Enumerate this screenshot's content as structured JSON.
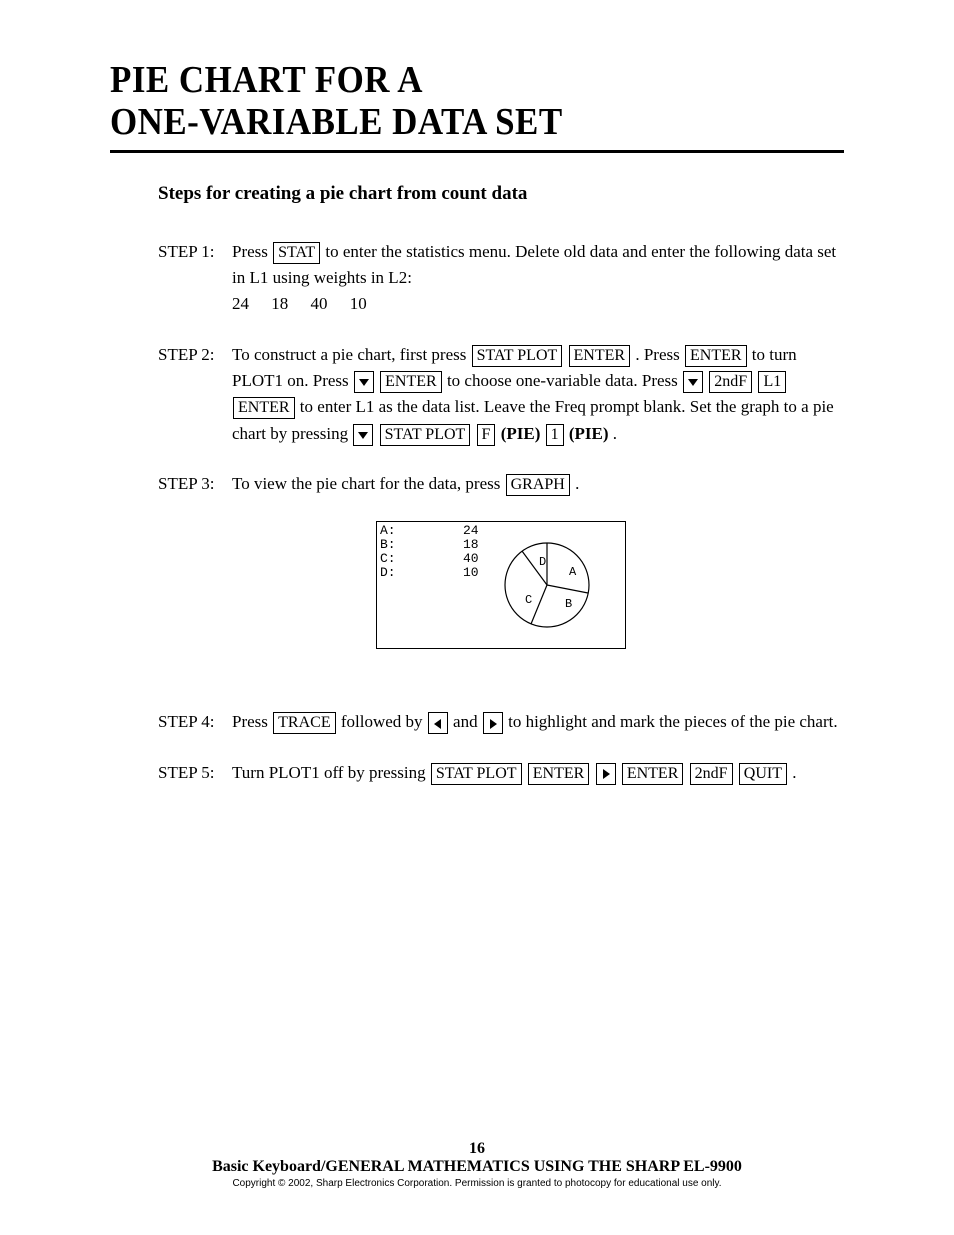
{
  "title": "PIE CHART FOR A\nONE-VARIABLE DATA SET",
  "subtitle": "Steps for creating a pie chart from count data",
  "steps": {
    "s1": {
      "label": "STEP 1:",
      "t1": "Press",
      "k1": "STAT",
      "t2": " to enter the statistics menu.  Delete old data and enter the following data set in L1 using weights in L2:",
      "data": "24    18    40    10"
    },
    "s2": {
      "label": "STEP 2:",
      "t1": "To construct a pie chart, first press ",
      "k1": "STAT PLOT",
      "k2": "ENTER",
      "t2": ".  Press ",
      "k3": "ENTER",
      "t3": " to turn PLOT1 on.  Press ",
      "k4": "▼",
      "k5": "ENTER",
      "t4": " to choose one-variable data.  Press ",
      "k6": "▼",
      "k7": "2ndF",
      "k8": "L1",
      "k9": "ENTER",
      "t5": " to enter L1 as the data list.  Leave the Freq prompt blank.  Set the graph to a pie chart by pressing ",
      "k10": "▼",
      "k11": "STAT PLOT",
      "k12": "F",
      "b1": "(PIE)",
      "k13": "1",
      "b2": "(PIE)",
      "t6": " ."
    },
    "s3": {
      "label": "STEP 3:",
      "t1": "To view the pie chart for the data, press ",
      "k1": "GRAPH",
      "t2": " ."
    },
    "s4": {
      "label": "STEP 4:",
      "t1": "Press ",
      "k1": "TRACE",
      "t2": " followed by ",
      "k2": "◀",
      "t3": " and ",
      "k3": "▶",
      "t4": " to highlight and mark the pieces of the pie chart."
    },
    "s5": {
      "label": "STEP 5:",
      "t1": "Turn PLOT1 off by pressing ",
      "k1": "STAT PLOT",
      "k2": "ENTER",
      "k3": "▶",
      "k4": "ENTER",
      "k5": "2ndF",
      "k6": "QUIT",
      "t2": " ."
    }
  },
  "screen": {
    "legend": "A:\nB:\nC:\nD:",
    "vals": "24\n18\n40\n10",
    "slice_labels": {
      "A": "A",
      "B": "B",
      "C": "C",
      "D": "D"
    }
  },
  "chart_data": {
    "type": "pie",
    "categories": [
      "A",
      "B",
      "C",
      "D"
    ],
    "values": [
      24,
      18,
      40,
      10
    ],
    "title": "",
    "legend": [
      "A:",
      "B:",
      "C:",
      "D:"
    ]
  },
  "footer": {
    "page": "16",
    "line": "Basic Keyboard/GENERAL MATHEMATICS USING THE SHARP EL-9900",
    "copyright": "Copyright © 2002, Sharp Electronics Corporation.  Permission is granted to photocopy for educational use only."
  }
}
